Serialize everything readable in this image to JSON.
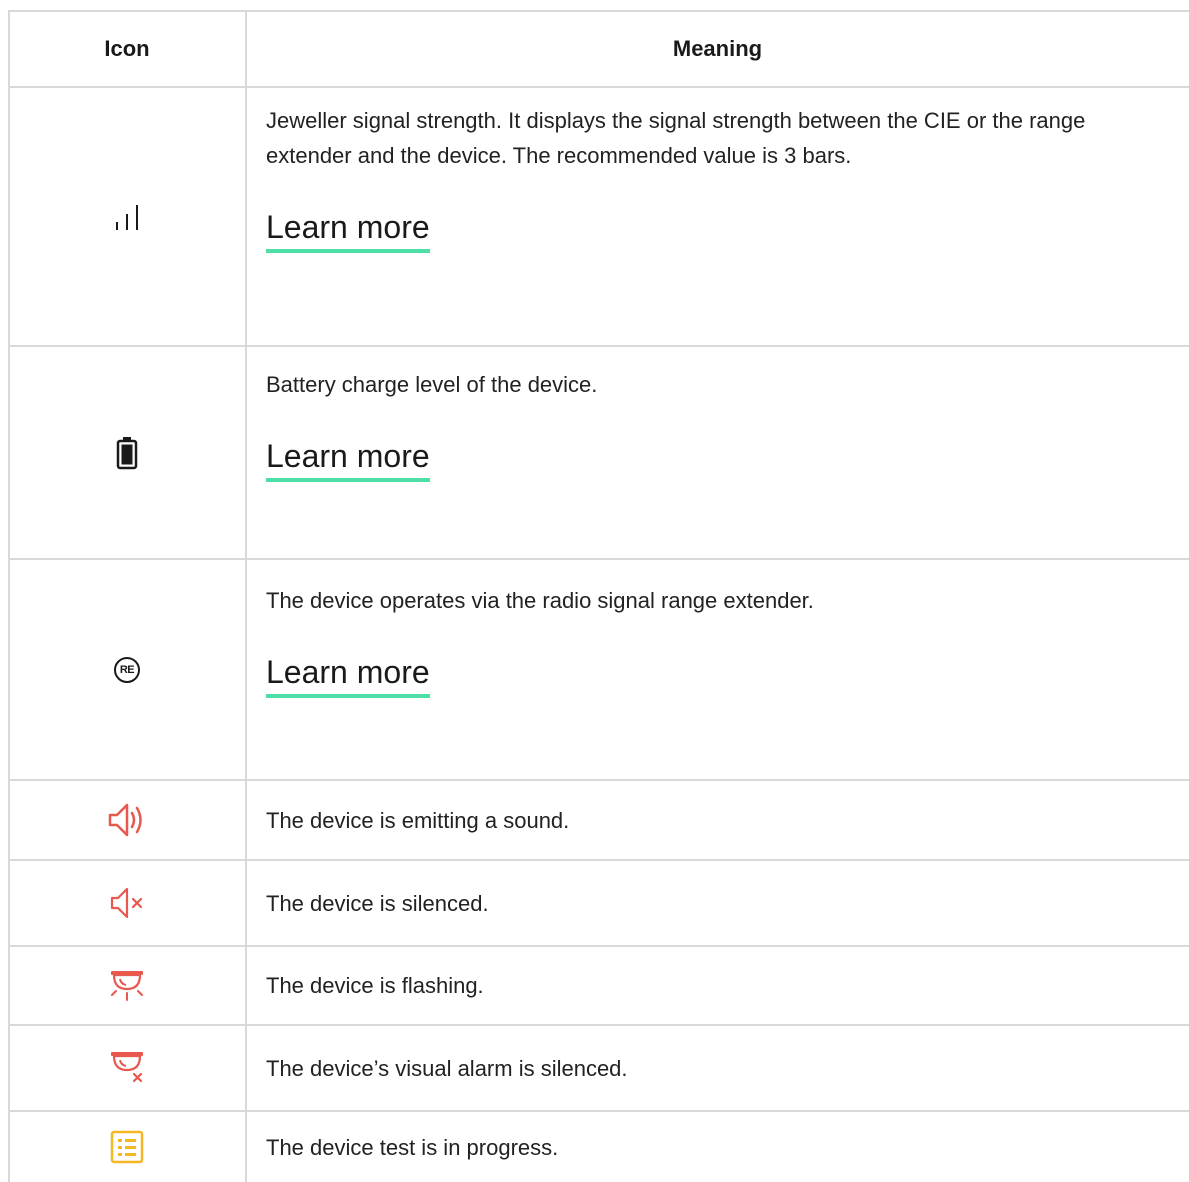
{
  "table": {
    "headers": {
      "icon": "Icon",
      "meaning": "Meaning"
    },
    "rows": [
      {
        "icon": "signal-strength-icon",
        "text": "Jeweller signal strength. It displays the signal strength between the CIE or the range extender and the device. The recommended value is 3 bars.",
        "link": "Learn more"
      },
      {
        "icon": "battery-icon",
        "text": "Battery charge level of the device.",
        "link": "Learn more"
      },
      {
        "icon": "range-extender-icon",
        "icon_label": "RE",
        "text": "The device operates via the radio signal range extender.",
        "link": "Learn more"
      },
      {
        "icon": "speaker-sound-icon",
        "text": "The device is emitting a sound."
      },
      {
        "icon": "speaker-muted-icon",
        "text": "The device is silenced."
      },
      {
        "icon": "flashing-light-icon",
        "text": "The device is flashing."
      },
      {
        "icon": "light-muted-icon",
        "text": "The device’s visual alarm is silenced."
      },
      {
        "icon": "test-checklist-icon",
        "text": "The device test is in progress."
      }
    ]
  },
  "colors": {
    "border": "#d9d9d9",
    "link_underline": "#4ddfa6",
    "alert_red": "#e8584f",
    "test_yellow": "#f5b724"
  }
}
